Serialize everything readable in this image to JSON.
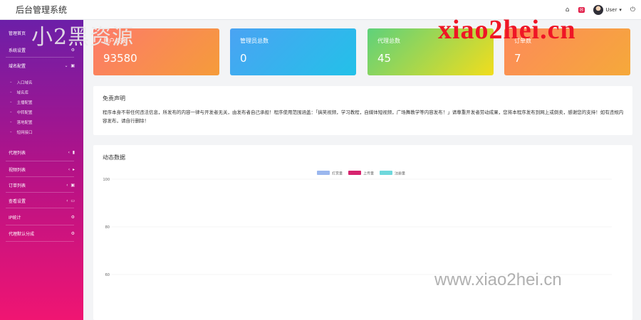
{
  "app": {
    "title": "后台管理系统"
  },
  "header": {
    "user_name": "User",
    "icons": {
      "home": "⌂",
      "mail": "✉",
      "logout": "⏻",
      "caret": "▾"
    }
  },
  "sidebar": {
    "items": [
      {
        "label": "管理首页",
        "icon": ""
      },
      {
        "label": "系统设置",
        "icon": "⚙"
      },
      {
        "label": "域名配置",
        "icon": "▣",
        "arrow": "⌄"
      },
      {
        "label": "代理列表",
        "icon": "▮",
        "arrow": "‹"
      },
      {
        "label": "视频列表",
        "icon": "▸",
        "arrow": "‹"
      },
      {
        "label": "订单列表",
        "icon": "▣",
        "arrow": "‹"
      },
      {
        "label": "查看设置",
        "icon": "▭",
        "arrow": "‹"
      },
      {
        "label": "IP统计",
        "icon": "⚙"
      },
      {
        "label": "代理默认分成",
        "icon": "⚙"
      }
    ],
    "subitems": [
      "入口域名",
      "域名库",
      "主播配置",
      "中转配置",
      "落地配置",
      "短网接口"
    ]
  },
  "stats": [
    {
      "label": "用户总数",
      "value": "93580"
    },
    {
      "label": "管理员总数",
      "value": "0"
    },
    {
      "label": "代理总数",
      "value": "45"
    },
    {
      "label": "订单数",
      "value": "7"
    }
  ],
  "disclaimer": {
    "title": "免责声明",
    "text": "程序本身不带任何违法信息，所发布的内容一律与开发者无关，由发布者自己承担！程序使用范围涵盖：「搞笑视频，学习教程，自媒体短视频，广场舞教学等内容发布！」请尊重开发者劳动成果，您将本程序发布到网上或倒卖，感谢您的支持！如有违规内容发布，请自行删除！"
  },
  "chart_panel": {
    "title": "动态数据"
  },
  "watermarks": {
    "cn": "小2黑资源",
    "logo": "xiao2hei.cn",
    "url": "www.xiao2hei.cn"
  },
  "colors": {
    "sidebar_top": "#6c1fa8",
    "sidebar_bottom": "#f01572",
    "series1": "#9bb7ee",
    "series2": "#d6246e",
    "series3": "#6fd8dc"
  },
  "chart_data": {
    "type": "line",
    "title": "动态数据",
    "series": [
      {
        "name": "打赏量",
        "values": []
      },
      {
        "name": "上传量",
        "values": []
      },
      {
        "name": "注册量",
        "values": []
      }
    ],
    "y_ticks": [
      "100",
      "80",
      "60"
    ],
    "ylim": [
      60,
      100
    ],
    "grid": true,
    "legend": "top-center"
  }
}
